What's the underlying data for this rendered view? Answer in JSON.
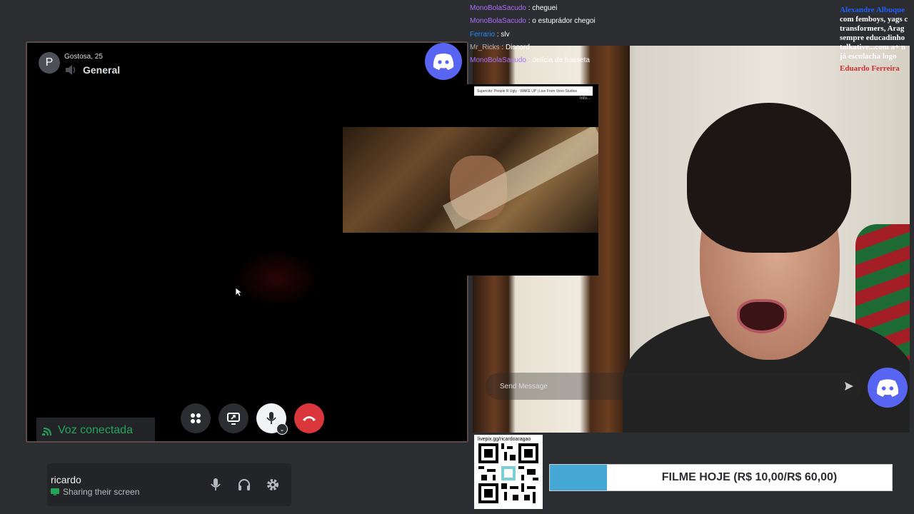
{
  "call": {
    "user_line": "Gostosa, 25",
    "avatar_letter": "P",
    "channel": "General",
    "voice_status": "Voz conectada"
  },
  "chat": {
    "messages": [
      {
        "user": "MonoBolaSacudo",
        "sep": " : ",
        "text": "cheguei",
        "color": "#a970ff"
      },
      {
        "user": "MonoBolaSacudo",
        "sep": " : ",
        "text": "o estuprádor chegoi",
        "color": "#a970ff"
      },
      {
        "user": "Ferrario",
        "sep": " : ",
        "text": "slv",
        "color": "#1e90ff"
      },
      {
        "user": "Mr_Ricks",
        "sep": " : ",
        "text": "Discord",
        "color": "#b0b0b0"
      },
      {
        "user": "MonoBolaSacudo",
        "sep": " : ",
        "text": "delícia de bosseta",
        "color": "#a970ff"
      }
    ]
  },
  "feed": {
    "name1": "Alexandre Albuque",
    "lines": [
      "com femboys, yags c",
      "transformers, Arag",
      "sempre educadinho"
    ],
    "line4": "talkative...com a+ n",
    "line5": "já esculacha logo",
    "name2": "Eduardo Ferreira"
  },
  "video": {
    "title": "Supercito: People R Ugly - WAKE UP | Live From Vevo Studios",
    "info": "Info..."
  },
  "message_bar": {
    "placeholder": "Send Message"
  },
  "user_panel": {
    "name": "ricardo",
    "status": "Sharing their screen"
  },
  "qr": {
    "url": "livepix.gg/ricardoaragao"
  },
  "goal": {
    "text": "FILME HOJE (R$ 10,00/R$ 60,00)",
    "current": 10,
    "target": 60,
    "progress_fraction": 0.1667
  },
  "colors": {
    "discord_blurple": "#5865f2",
    "voice_green": "#23a55a",
    "hangup_red": "#da373c",
    "goal_fill": "#45a8d4"
  }
}
